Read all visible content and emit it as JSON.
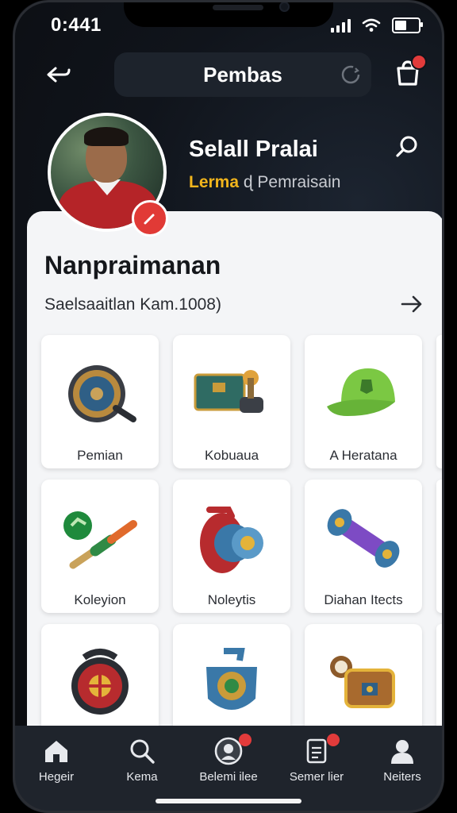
{
  "status": {
    "time": "0:441"
  },
  "header": {
    "title": "Pembas"
  },
  "profile": {
    "name": "Selall Pralai",
    "sub_accent": "Lerma",
    "sub_rest": " ɖ Pemraisain"
  },
  "section": {
    "title": "Nanpraimanan",
    "subtitle": "Saelsaaitlan Kam.1008)"
  },
  "items": [
    {
      "label": "Pemian",
      "icon": "shield-gear-icon"
    },
    {
      "label": "Kobuaua",
      "icon": "machine-crate-icon"
    },
    {
      "label": "A Heratana",
      "icon": "green-cap-icon"
    },
    {
      "label": "Koleyion",
      "icon": "green-wand-icon"
    },
    {
      "label": "Noleytis",
      "icon": "red-blue-device-icon"
    },
    {
      "label": "Diahan Itects",
      "icon": "dumbbell-icon"
    },
    {
      "label": "",
      "icon": "red-gear-icon"
    },
    {
      "label": "",
      "icon": "blue-shield-icon"
    },
    {
      "label": "",
      "icon": "treasure-chest-icon"
    }
  ],
  "tabs": [
    {
      "label": "Hegeir",
      "icon": "home-icon",
      "badge": ""
    },
    {
      "label": "Kema",
      "icon": "search-icon",
      "badge": ""
    },
    {
      "label": "Belemi ilee",
      "icon": "avatar-icon",
      "badge": ""
    },
    {
      "label": "Semer lier",
      "icon": "document-icon",
      "badge": ""
    },
    {
      "label": "Neiters",
      "icon": "person-icon",
      "badge": ""
    }
  ],
  "colors": {
    "accent": "#e23b3b",
    "yellow": "#f2b51c",
    "card": "#f4f5f7",
    "tabbar": "#1f242c"
  }
}
